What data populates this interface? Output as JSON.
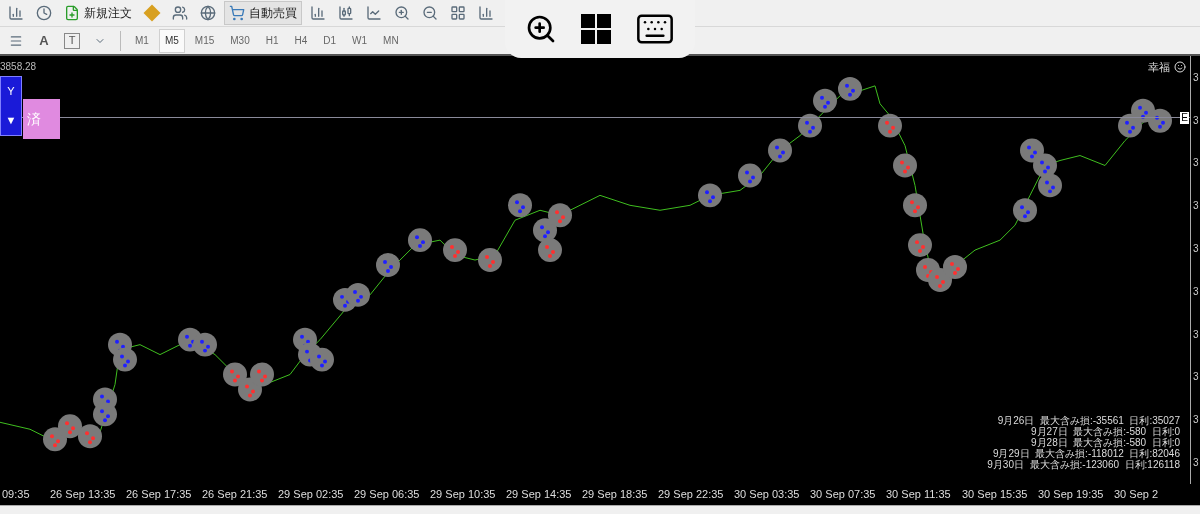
{
  "toolbar": {
    "new_order": {
      "label": "新規注文"
    },
    "auto_trading": {
      "label": "自動売買",
      "on": true
    }
  },
  "drawing_toolbar": {
    "text_tool": "A",
    "label_tool": "T"
  },
  "timeframes": [
    {
      "label": "M1",
      "selected": false
    },
    {
      "label": "M5",
      "selected": true
    },
    {
      "label": "M15",
      "selected": false
    },
    {
      "label": "M30",
      "selected": false
    },
    {
      "label": "H1",
      "selected": false
    },
    {
      "label": "H4",
      "selected": false
    },
    {
      "label": "D1",
      "selected": false
    },
    {
      "label": "W1",
      "selected": false
    },
    {
      "label": "MN",
      "selected": false
    }
  ],
  "chart": {
    "price_label": "3858.28",
    "buy_button": {
      "top": "Y",
      "bottom": "▼"
    },
    "close_button": {
      "label": "済"
    },
    "indicator_name": "幸福",
    "line_marker": "E",
    "stats": [
      "9月26日  最大含み損:-35561  日利:35027",
      "9月27日  最大含み損:-580  日利:0",
      "9月28日  最大含み損:-580  日利:0",
      "9月29日  最大含み損:-118012  日利:82046",
      "9月30日  最大含み損:-123060  日利:126118"
    ],
    "y_axis": [
      "3",
      "3",
      "3",
      "3",
      "3",
      "3",
      "3",
      "3",
      "3",
      "3"
    ],
    "time_axis": [
      "09:35",
      "26 Sep 13:35",
      "26 Sep 17:35",
      "26 Sep 21:35",
      "29 Sep 02:35",
      "29 Sep 06:35",
      "29 Sep 10:35",
      "29 Sep 14:35",
      "29 Sep 18:35",
      "29 Sep 22:35",
      "30 Sep 03:35",
      "30 Sep 07:35",
      "30 Sep 11:35",
      "30 Sep 15:35",
      "30 Sep 19:35",
      "30 Sep 2"
    ]
  }
}
